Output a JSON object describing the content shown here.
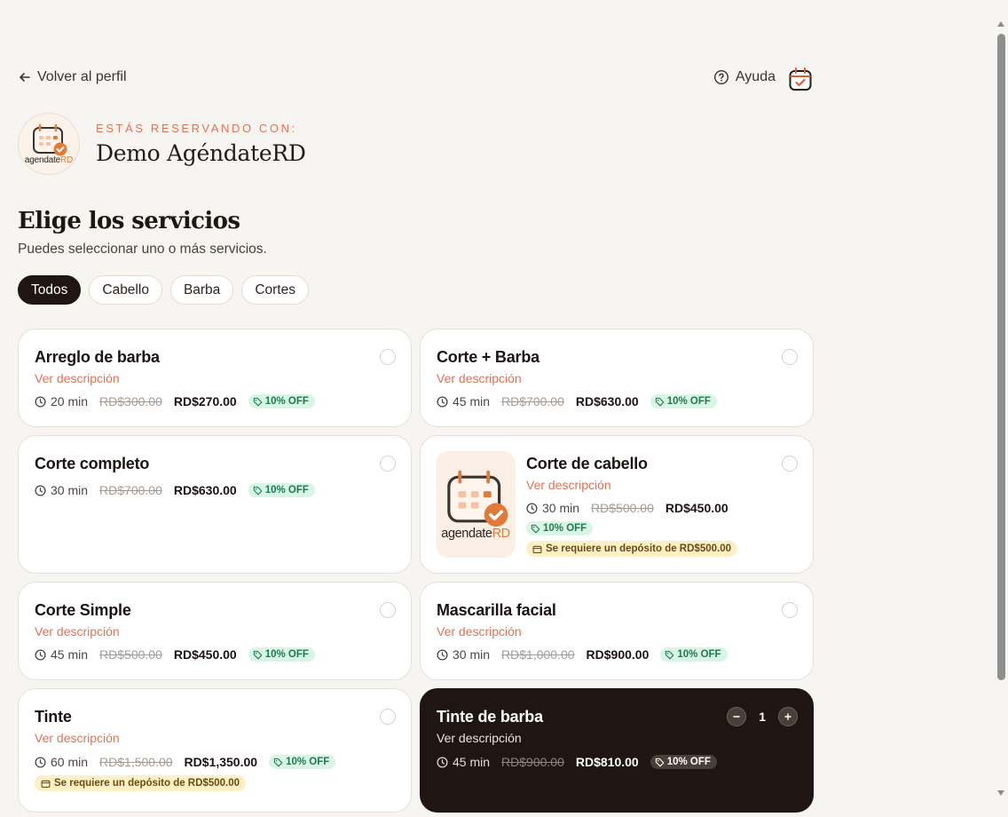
{
  "nav": {
    "back_label": "Volver al perfil",
    "help_label": "Ayuda"
  },
  "business": {
    "eyebrow": "ESTÁS RESERVANDO CON:",
    "name": "Demo AgéndateRD",
    "logo_text": "agendate",
    "logo_accent": "RD"
  },
  "heading": {
    "title": "Elige los servicios",
    "subtitle": "Puedes seleccionar uno o más servicios."
  },
  "filters": [
    {
      "label": "Todos",
      "active": true
    },
    {
      "label": "Cabello",
      "active": false
    },
    {
      "label": "Barba",
      "active": false
    },
    {
      "label": "Cortes",
      "active": false
    }
  ],
  "services": [
    {
      "title": "Arreglo de barba",
      "link": "Ver descripción",
      "duration": "20 min",
      "old_price": "RD$300.00",
      "price": "RD$270.00",
      "discount": "10% OFF"
    },
    {
      "title": "Corte + Barba",
      "link": "Ver descripción",
      "duration": "45 min",
      "old_price": "RD$700.00",
      "price": "RD$630.00",
      "discount": "10% OFF"
    },
    {
      "title": "Corte completo",
      "duration": "30 min",
      "old_price": "RD$700.00",
      "price": "RD$630.00",
      "discount": "10% OFF"
    },
    {
      "title": "Corte de cabello",
      "link": "Ver descripción",
      "duration": "30 min",
      "old_price": "RD$500.00",
      "price": "RD$450.00",
      "discount": "10% OFF",
      "deposit": "Se requiere un depósito de RD$500.00",
      "thumb_text": "agendate",
      "thumb_accent": "RD"
    },
    {
      "title": "Corte Simple",
      "link": "Ver descripción",
      "duration": "45 min",
      "old_price": "RD$500.00",
      "price": "RD$450.00",
      "discount": "10% OFF"
    },
    {
      "title": "Mascarilla facial",
      "link": "Ver descripción",
      "duration": "30 min",
      "old_price": "RD$1,000.00",
      "price": "RD$900.00",
      "discount": "10% OFF"
    },
    {
      "title": "Tinte",
      "link": "Ver descripción",
      "duration": "60 min",
      "old_price": "RD$1,500.00",
      "price": "RD$1,350.00",
      "discount": "10% OFF",
      "deposit": "Se requiere un depósito de RD$500.00"
    },
    {
      "title": "Tinte de barba",
      "link": "Ver descripción",
      "duration": "45 min",
      "old_price": "RD$900.00",
      "price": "RD$810.00",
      "discount": "10% OFF",
      "quantity": "1",
      "selected": true
    }
  ],
  "icons": {
    "back": "arrow-left-icon",
    "help": "question-circle-icon",
    "calendar": "calendar-check-icon",
    "clock": "clock-icon",
    "tag": "tag-icon",
    "deposit": "wallet-icon",
    "minus": "minus-icon",
    "plus": "plus-icon"
  },
  "colors": {
    "accent": "#e07356",
    "dark": "#1f1512",
    "discount_bg": "#d9f5e6",
    "deposit_bg": "#fdf0c7"
  }
}
